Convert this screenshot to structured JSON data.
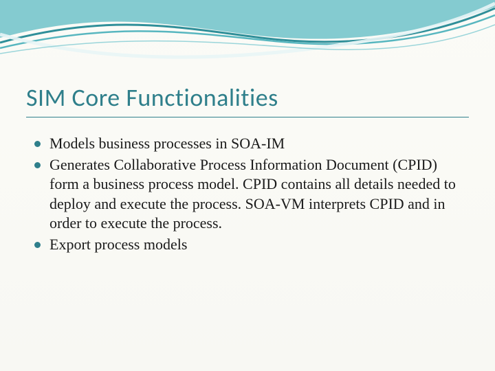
{
  "slide": {
    "title": "SIM Core Functionalities",
    "bullets": [
      "Models business processes in SOA-IM",
      "Generates Collaborative Process Information Document (CPID) form a business process model. CPID contains all details needed to deploy and execute the process. SOA-VM interprets CPID and in order to execute the process.",
      "Export process models"
    ],
    "accent_color": "#2f7f8b"
  }
}
